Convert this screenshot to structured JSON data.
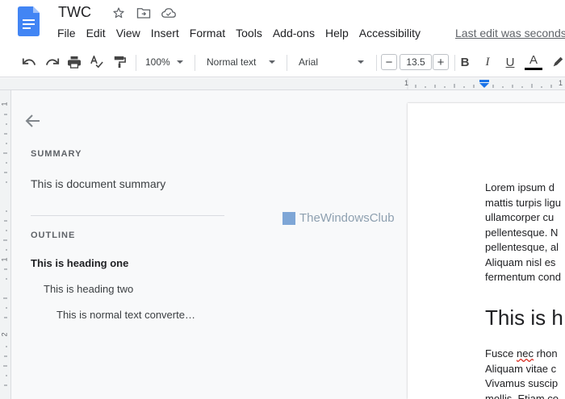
{
  "header": {
    "title": "TWC",
    "menu": [
      "File",
      "Edit",
      "View",
      "Insert",
      "Format",
      "Tools",
      "Add-ons",
      "Help",
      "Accessibility"
    ],
    "last_edit": "Last edit was seconds ago"
  },
  "toolbar": {
    "zoom": "100%",
    "style": "Normal text",
    "font": "Arial",
    "font_size": "13.5",
    "minus": "−",
    "plus": "+",
    "bold": "B",
    "italic": "I",
    "underline": "U",
    "text_color": "A"
  },
  "ruler": {
    "top_marks": [
      "1",
      "1"
    ],
    "left_marks": [
      "1",
      "1",
      "2"
    ]
  },
  "outline_panel": {
    "summary_label": "SUMMARY",
    "summary_text": "This is document summary",
    "outline_label": "OUTLINE",
    "items": [
      {
        "text": "This is heading one"
      },
      {
        "text": "This is heading two"
      },
      {
        "text": "This is normal text converte…"
      }
    ],
    "watermark": "TheWindowsClub"
  },
  "document": {
    "para1": [
      "Lorem ipsum d",
      "mattis turpis ligu",
      "ullamcorper cu",
      "pellentesque. N",
      "pellentesque, al",
      "Aliquam nisl es",
      "fermentum cond"
    ],
    "heading": "This is h",
    "para2_first_a": "Fusce ",
    "para2_first_b": "nec",
    "para2_first_c": " rhon",
    "para2_rest": [
      "Aliquam vitae c",
      "Vivamus suscip",
      "mollis. Etiam co"
    ]
  },
  "colors": {
    "accent": "#1a73e8",
    "doc_icon": "#4285f4"
  }
}
